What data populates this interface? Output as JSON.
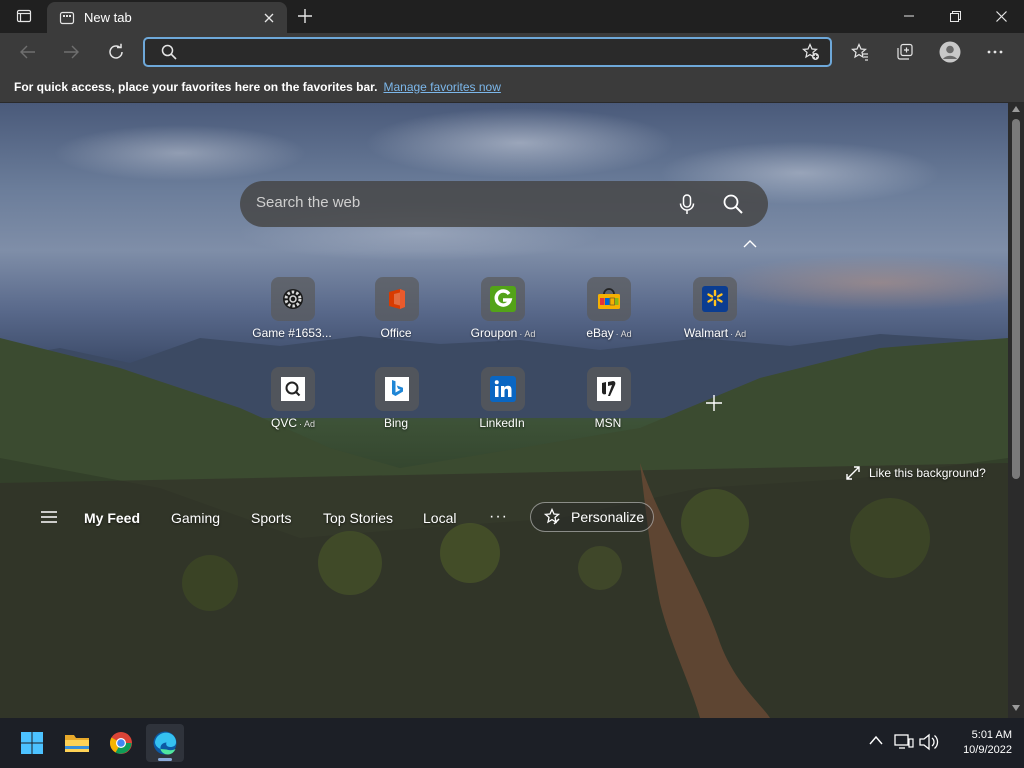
{
  "browser": {
    "tab": {
      "title": "New tab"
    },
    "address": {
      "value": "",
      "placeholder": ""
    }
  },
  "favorites_bar": {
    "message": "For quick access, place your favorites here on the favorites bar.",
    "link": "Manage favorites now"
  },
  "newtab": {
    "search": {
      "placeholder": "Search the web"
    },
    "tiles": [
      {
        "label": "Game #1653...",
        "ad": "",
        "icon": "gear-icon"
      },
      {
        "label": "Office",
        "ad": "",
        "icon": "office-icon"
      },
      {
        "label": "Groupon",
        "ad": "· Ad",
        "icon": "groupon-icon"
      },
      {
        "label": "eBay",
        "ad": "· Ad",
        "icon": "ebay-icon"
      },
      {
        "label": "Walmart",
        "ad": "· Ad",
        "icon": "walmart-icon"
      },
      {
        "label": "QVC",
        "ad": "· Ad",
        "icon": "qvc-icon"
      },
      {
        "label": "Bing",
        "ad": "",
        "icon": "bing-icon"
      },
      {
        "label": "LinkedIn",
        "ad": "",
        "icon": "linkedin-icon"
      },
      {
        "label": "MSN",
        "ad": "",
        "icon": "msn-icon"
      }
    ],
    "like_background": "Like this background?",
    "feed": {
      "items": [
        "My Feed",
        "Gaming",
        "Sports",
        "Top Stories",
        "Local"
      ],
      "more": "···",
      "personalize": "Personalize"
    }
  },
  "taskbar": {
    "apps": [
      "start-icon",
      "file-explorer-icon",
      "chrome-icon",
      "edge-icon"
    ],
    "time": "5:01 AM",
    "date": "10/9/2022"
  },
  "colors": {
    "accent": "#6ea8d9",
    "link": "#7cb7ea",
    "taskbar": "#1c1f26"
  }
}
